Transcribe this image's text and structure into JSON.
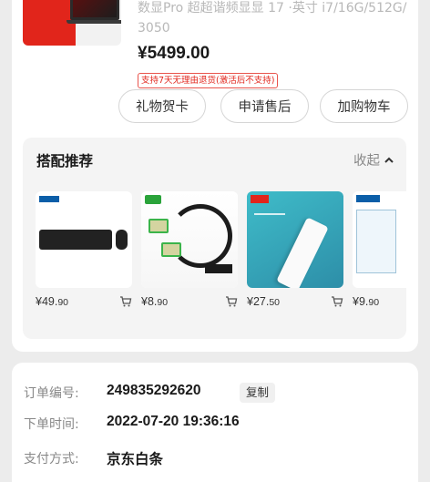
{
  "product": {
    "title_line1": "数显Pro 超超谐频显显 17 ·英寸 i7/16G/512G/",
    "title_line2": "3050",
    "thumb_promo": "",
    "price": "¥5499.00",
    "return_policy": "支持7天无理由退货(激活后不支持)",
    "buttons": {
      "gift": "礼物贺卡",
      "after_sales": "申请售后",
      "add_cart": "加购物车"
    }
  },
  "recommend": {
    "title": "搭配推荐",
    "collapse": "收起",
    "items": [
      {
        "price_int": "¥49.",
        "price_dec": "90",
        "kind": "keyboard-mouse"
      },
      {
        "price_int": "¥8.",
        "price_dec": "90",
        "kind": "network-cable"
      },
      {
        "price_int": "¥27.",
        "price_dec": "50",
        "kind": "power-strip"
      },
      {
        "price_int": "¥9.",
        "price_dec": "90",
        "kind": "audio-jack"
      }
    ]
  },
  "order": {
    "number_label": "订单编号:",
    "number_value": "249835292620",
    "copy_label": "复制",
    "time_label": "下单时间:",
    "time_value": "2022-07-20 19:36:16",
    "pay_label": "支付方式:",
    "pay_value": "京东白条"
  },
  "colors": {
    "accent_red": "#e1251b",
    "page_bg": "#ececec"
  }
}
